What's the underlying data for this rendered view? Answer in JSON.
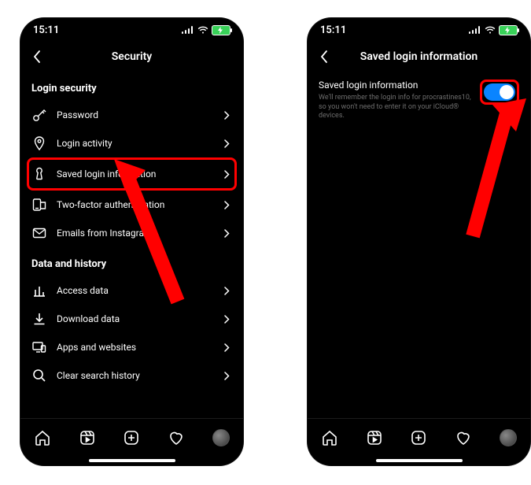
{
  "status": {
    "time": "15:11"
  },
  "left": {
    "header": {
      "title": "Security"
    },
    "section1": {
      "title": "Login security"
    },
    "items1": [
      {
        "name": "password",
        "label": "Password"
      },
      {
        "name": "login-activity",
        "label": "Login activity"
      },
      {
        "name": "saved-login",
        "label": "Saved login information"
      },
      {
        "name": "two-factor",
        "label": "Two-factor authentication"
      },
      {
        "name": "emails",
        "label": "Emails from Instagram"
      }
    ],
    "section2": {
      "title": "Data and history"
    },
    "items2": [
      {
        "name": "access-data",
        "label": "Access data"
      },
      {
        "name": "download-data",
        "label": "Download data"
      },
      {
        "name": "apps-websites",
        "label": "Apps and websites"
      },
      {
        "name": "clear-search",
        "label": "Clear search history"
      }
    ]
  },
  "right": {
    "header": {
      "title": "Saved login information"
    },
    "setting": {
      "title": "Saved login information",
      "desc": "We'll remember the login info for procrastines10, so you won't need to enter it on your iCloud® devices."
    }
  }
}
